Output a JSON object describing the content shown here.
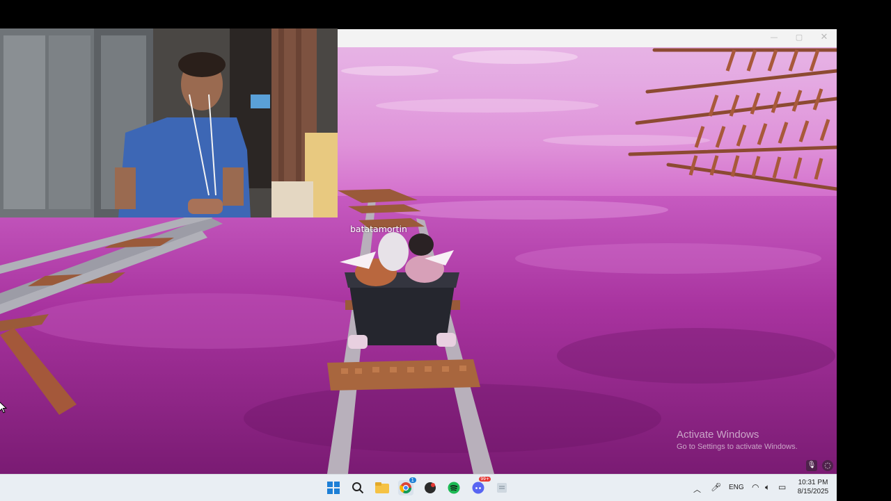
{
  "game": {
    "player_name": "batatamortin"
  },
  "window": {
    "minimize_symbol": "—",
    "maximize_symbol": "▢",
    "close_symbol": "✕"
  },
  "watermark": {
    "title": "Activate Windows",
    "subtitle": "Go to Settings to activate Windows."
  },
  "taskbar": {
    "icons": [
      "windows-start-icon",
      "search-icon",
      "file-explorer-icon",
      "chrome-icon",
      "app-icon",
      "spotify-icon",
      "discord-icon",
      "notepad-icon"
    ],
    "chrome_badge": "1",
    "discord_badge": "99+",
    "tray": {
      "language": "ENG",
      "time": "10:31 PM",
      "date": "8/15/2025"
    }
  },
  "colors": {
    "sky": "#e4a9e2",
    "water": "#9a2b8f",
    "rail": "#a0a0a8",
    "tie": "#9a5a3a",
    "taskbar": "#e9eef3"
  }
}
